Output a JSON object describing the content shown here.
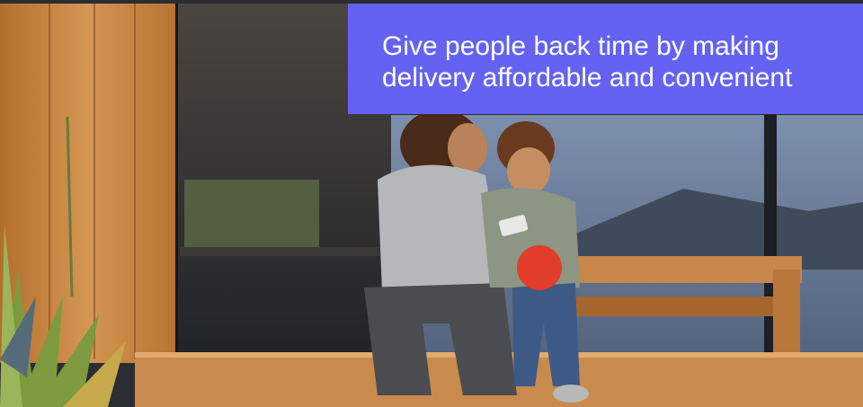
{
  "slide": {
    "headline": "Give people back time by making delivery affordable and convenient"
  },
  "colors": {
    "callout_background": "#6462F2",
    "callout_text": "#FFFFFF"
  }
}
